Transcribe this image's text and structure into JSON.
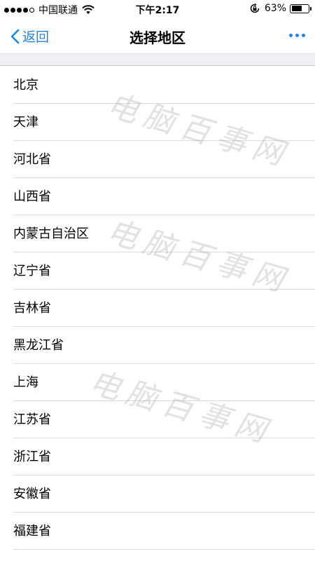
{
  "status_bar": {
    "carrier": "中国联通",
    "time": "下午2:17",
    "battery_percent_text": "63%",
    "battery_level": 0.63,
    "signal_bars_filled": 4,
    "signal_bars_total": 5
  },
  "nav": {
    "back_label": "返回",
    "title": "选择地区",
    "more_icon": "ellipsis-icon"
  },
  "regions": [
    "北京",
    "天津",
    "河北省",
    "山西省",
    "内蒙古自治区",
    "辽宁省",
    "吉林省",
    "黑龙江省",
    "上海",
    "江苏省",
    "浙江省",
    "安徽省",
    "福建省"
  ],
  "watermark": {
    "text": "电脑百事网"
  },
  "colors": {
    "accent": "#1b84f4",
    "separator": "#dcdce0",
    "section_bg": "#efeff4"
  }
}
